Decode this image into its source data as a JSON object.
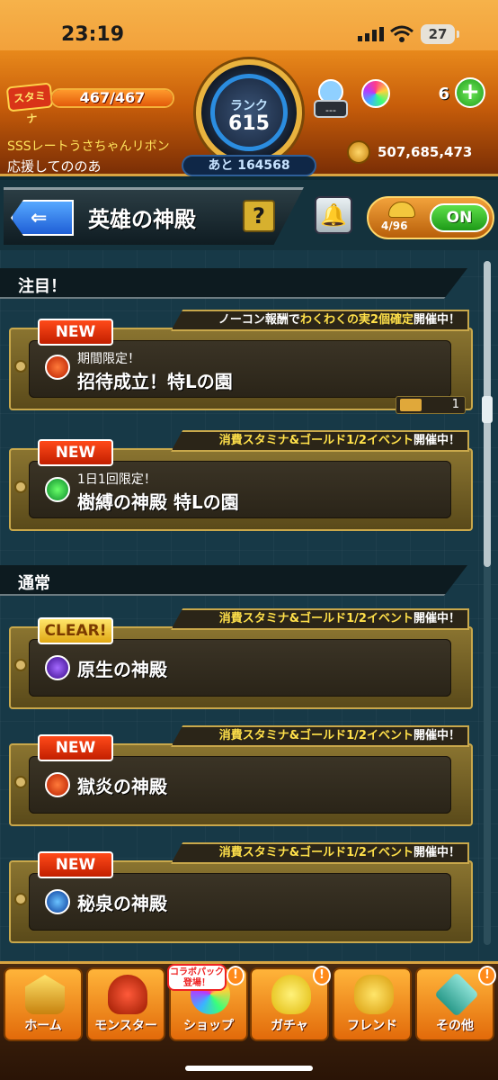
{
  "status_bar": {
    "time": "23:19",
    "battery": "27"
  },
  "header": {
    "stamina_label": "スタミナ",
    "stamina_value": "467/467",
    "stamina_fill": 1.0,
    "rank_label": "ランク",
    "rank_value": "615",
    "rank_next": "あと 164568",
    "user_title": "SSSレートうさちゃんリボン",
    "user_name": "応援してののあ",
    "lamp_value": "---",
    "orb_count": "6",
    "plus_label": "+",
    "gold_count": "507,685,473"
  },
  "subheader": {
    "back_arrow": "⇐",
    "title": "英雄の神殿",
    "help_label": "?",
    "bell_icon": "🔔",
    "helper_count": "4/96",
    "toggle_label": "ON"
  },
  "sections": {
    "featured": "注目！",
    "normal": "通常"
  },
  "quests": [
    {
      "badge": "NEW",
      "banner_pre": "ノーコン報酬で",
      "banner_hl": "わくわくの実2個確定",
      "banner_post": "開催中！",
      "sub": "期間限定！",
      "name": "招待成立！特Lの園",
      "ticket": "1",
      "element": "fire"
    },
    {
      "badge": "NEW",
      "banner_pre": "",
      "banner_hl": "消費スタミナ&ゴールド1/2イベント",
      "banner_post": "開催中！",
      "sub": "1日1回限定！",
      "name": "樹縛の神殿 特Lの園",
      "element": "wood"
    },
    {
      "badge": "CLEAR!",
      "banner_pre": "",
      "banner_hl": "消費スタミナ&ゴールド1/2イベント",
      "banner_post": "開催中！",
      "name": "原生の神殿",
      "element": "dark"
    },
    {
      "badge": "NEW",
      "banner_pre": "",
      "banner_hl": "消費スタミナ&ゴールド1/2イベント",
      "banner_post": "開催中！",
      "name": "獄炎の神殿",
      "element": "fire"
    },
    {
      "badge": "NEW",
      "banner_pre": "",
      "banner_hl": "消費スタミナ&ゴールド1/2イベント",
      "banner_post": "開催中！",
      "name": "秘泉の神殿",
      "element": "water"
    }
  ],
  "bottom_nav": {
    "home": "ホーム",
    "monster": "モンスター",
    "shop": "ショップ",
    "gacha": "ガチャ",
    "friend": "フレンド",
    "other": "その他",
    "collab_tag": "コラボパック登場！",
    "excl": "!"
  },
  "colors": {
    "accent": "#e8891b",
    "new_badge": "#ff4a1a",
    "clear_badge": "#ffe56a",
    "on_toggle": "#5ee04a",
    "highlight": "#ffe04a"
  }
}
